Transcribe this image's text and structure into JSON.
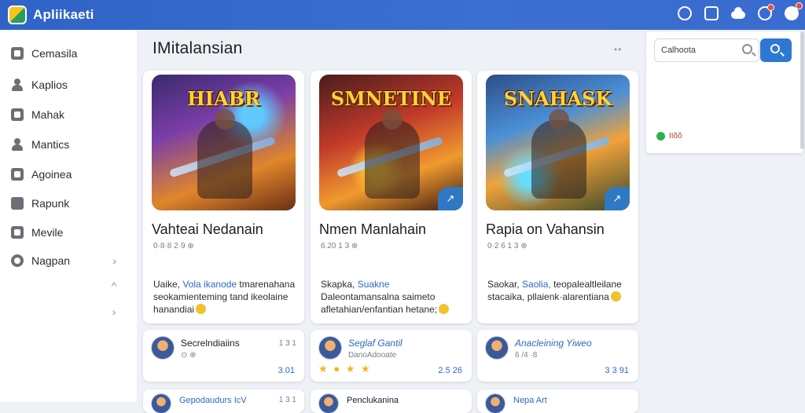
{
  "app": {
    "title": "Apliikaeti"
  },
  "topbar": {
    "icons": [
      "chat-icon",
      "lock-icon",
      "cloud-icon",
      "notification-icon",
      "user-avatar-icon"
    ]
  },
  "sidebar": {
    "items": [
      {
        "label": "Cemasila",
        "icon": "dashboard-icon"
      },
      {
        "label": "Kaplios",
        "icon": "person-icon"
      },
      {
        "label": "Mahak",
        "icon": "document-icon"
      },
      {
        "label": "Mantics",
        "icon": "person-icon"
      },
      {
        "label": "Agoinea",
        "icon": "box-icon"
      },
      {
        "label": "Rapunk",
        "icon": "edit-icon"
      },
      {
        "label": "Mevile",
        "icon": "media-icon"
      },
      {
        "label": "Nagpan",
        "icon": "circle-icon"
      }
    ],
    "chevron": "›",
    "extra_chevrons": [
      "^",
      "›"
    ]
  },
  "main": {
    "section_title": "IMitalansian",
    "more": "••"
  },
  "cards": [
    {
      "art_title": "HIABR",
      "title": "Vahteai Nedanain",
      "meta": "0·8·8 2·9 ⊕",
      "desc_pre": "Uaike, ",
      "desc_hl": "Vola ikanode",
      "desc_post": " tmarenahana seokamienteming tand ikeolaine hanandiai",
      "share": false
    },
    {
      "art_title": "SMNETINE",
      "title": "Nmen Manlahain",
      "meta": "6.20 1 3 ⊕",
      "desc_pre": "Skapka, ",
      "desc_hl": "Suakne",
      "desc_post": " Daleontamansalna saimeto afletahian/enfantian hetane;",
      "share": true
    },
    {
      "art_title": "SNAHASK",
      "title": "Rapia on Vahansin",
      "meta": "0·2 6 1 3 ⊕",
      "desc_pre": "Saokar, ",
      "desc_hl": "Saolia,",
      "desc_post": " teopalealtleilane stacaika, pllaienk·alarentiana",
      "share": true
    }
  ],
  "mini_cards": [
    {
      "name": "Secrelndiaiins",
      "sub": "⊙  ⊕",
      "num": "1 3 1",
      "foot": "3.01",
      "stars": "",
      "blue": false
    },
    {
      "name": "Seglaf Gantil",
      "sub": "DanoAdooate",
      "num": "",
      "foot": "2.5 26",
      "stars": "★ ● ★ ★",
      "blue": true
    },
    {
      "name": "Anacleining Yiweo",
      "sub": "6 /4 ·8",
      "num": "",
      "foot": "3 3 91",
      "stars": "",
      "blue": true
    }
  ],
  "mini_cards_row2": [
    {
      "name": "Gepodaudurs IcV",
      "num": "1 3 1",
      "blue": true
    },
    {
      "name": "Penclukanina",
      "num": "",
      "blue": false
    },
    {
      "name": "Nepa Art",
      "num": "",
      "blue": true
    }
  ],
  "panel": {
    "search_placeholder": "Calhoota",
    "status_text": "IIŏŏ"
  }
}
